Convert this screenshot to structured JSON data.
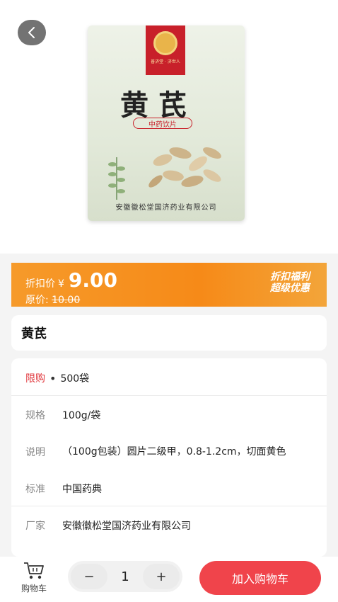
{
  "icons": {
    "back": "chevron-left-icon",
    "cart": "shopping-cart-icon"
  },
  "product_image": {
    "seal_text": "普济堂 · 济世人",
    "title": "黄芪",
    "tag": "中药饮片",
    "maker": "安徽徽松堂国济药业有限公司"
  },
  "price": {
    "label": "折扣价",
    "currency": "¥",
    "value": "9.00",
    "original_label": "原价:",
    "original_value": "10.00",
    "promo_line1": "折扣福利",
    "promo_line2": "超级优惠"
  },
  "product": {
    "name": "黄芪"
  },
  "details": {
    "limit_label": "限购",
    "limit_dot": "•",
    "limit_value": "500袋",
    "spec_label": "规格",
    "spec_value": "100g/袋",
    "desc_label": "说明",
    "desc_value": "（100g包装）圆片二级甲，0.8-1.2cm，切面黄色",
    "standard_label": "标准",
    "standard_value": "中国药典",
    "maker_label": "厂家",
    "maker_value": "安徽徽松堂国济药业有限公司"
  },
  "bottom": {
    "cart_label": "购物车",
    "minus": "−",
    "quantity": "1",
    "plus": "+",
    "add_to_cart": "加入购物车"
  },
  "colors": {
    "accent_red": "#f0444b",
    "limit_red": "#e0343a",
    "banner_orange": "#f68a18"
  }
}
